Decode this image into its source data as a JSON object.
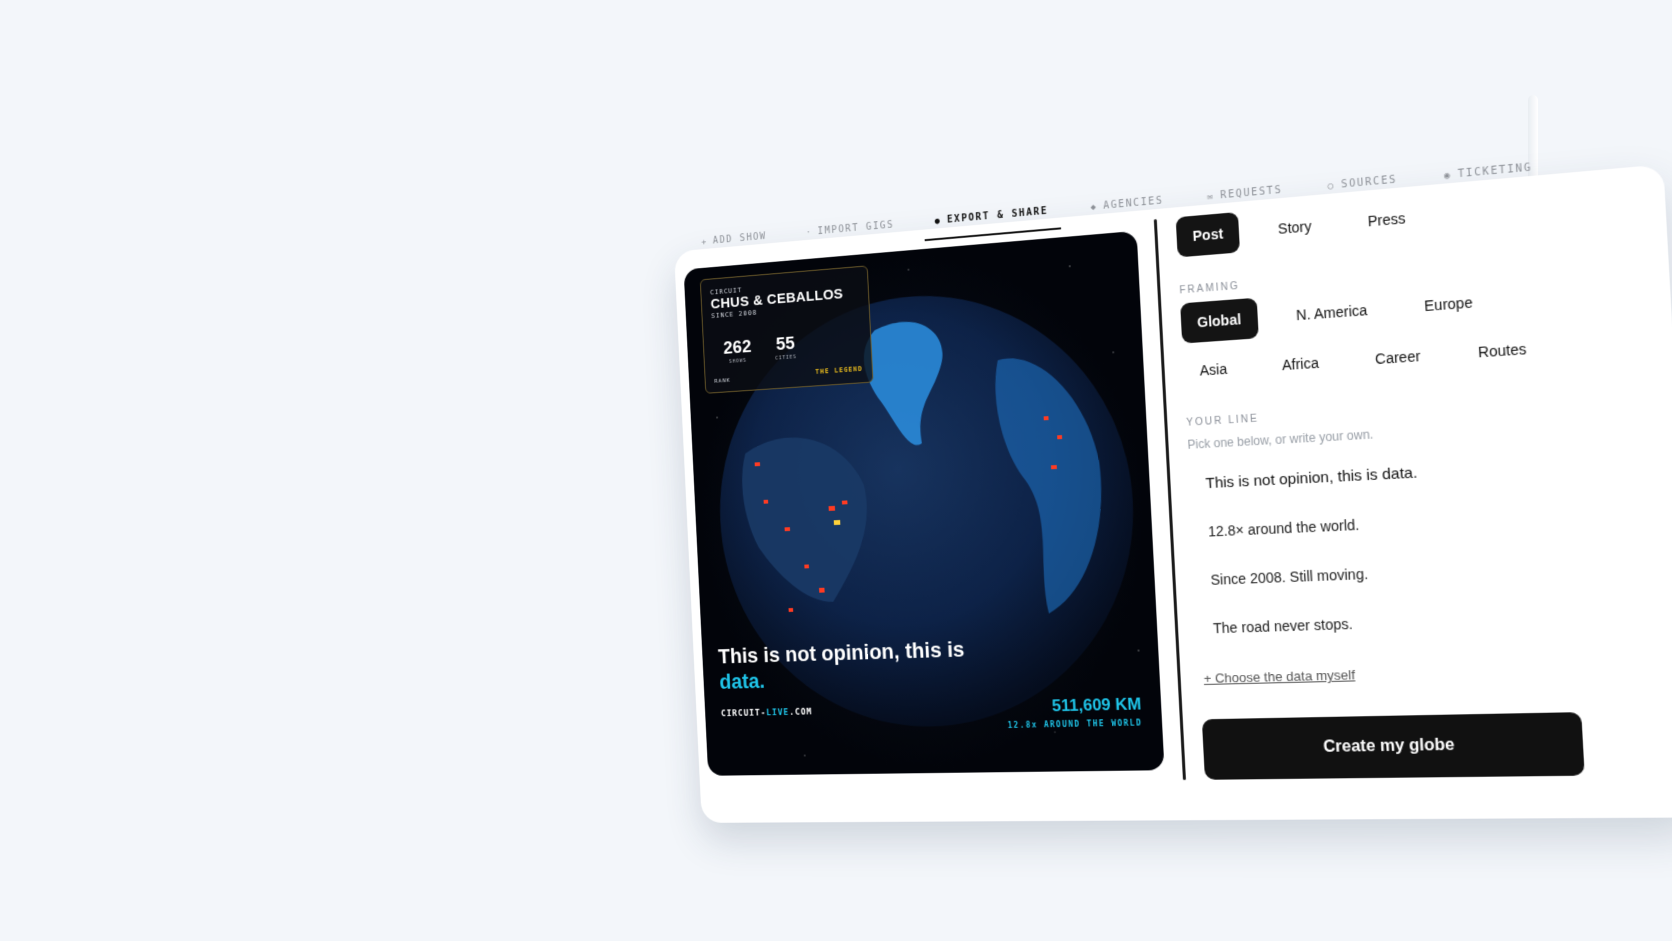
{
  "tabs": [
    {
      "icon": "+",
      "label": "ADD SHOW"
    },
    {
      "icon": "·",
      "label": "IMPORT GIGS"
    },
    {
      "icon": "●",
      "label": "EXPORT & SHARE"
    },
    {
      "icon": "◆",
      "label": "AGENCIES"
    },
    {
      "icon": "✉",
      "label": "REQUESTS"
    },
    {
      "icon": "○",
      "label": "SOURCES"
    },
    {
      "icon": "◉",
      "label": "TICKETING"
    }
  ],
  "globe_card": {
    "circuit_label": "CIRCUIT",
    "artist": "CHUS & CEBALLOS",
    "since": "SINCE 2008",
    "shows": "262",
    "shows_label": "SHOWS",
    "cities": "55",
    "cities_label": "CITIES",
    "rank_label": "RANK",
    "rank_value": "THE LEGEND",
    "tagline_main": "This is not opinion, this is",
    "tagline_highlight": "data.",
    "site_a": "CIRCUIT-",
    "site_b": "LIVE",
    "site_c": ".COM",
    "distance": "511,609 KM",
    "around": "12.8x AROUND THE WORLD"
  },
  "format_options": [
    "Post",
    "Story",
    "Press"
  ],
  "framing": {
    "label": "FRAMING",
    "row1": [
      "Global",
      "N. America",
      "Europe"
    ],
    "row2": [
      "Asia",
      "Africa",
      "Career",
      "Routes"
    ]
  },
  "your_line": {
    "label": "YOUR LINE",
    "hint": "Pick one below, or write your own.",
    "options": [
      "This is not opinion, this is data.",
      "12.8× around the world.",
      "Since 2008. Still moving.",
      "The road never stops."
    ],
    "choose": "+ Choose the data myself"
  },
  "create_button": "Create my globe",
  "colors": {
    "accent": "#1fc4e8",
    "legend": "#e1b51d",
    "dark": "#141414"
  }
}
